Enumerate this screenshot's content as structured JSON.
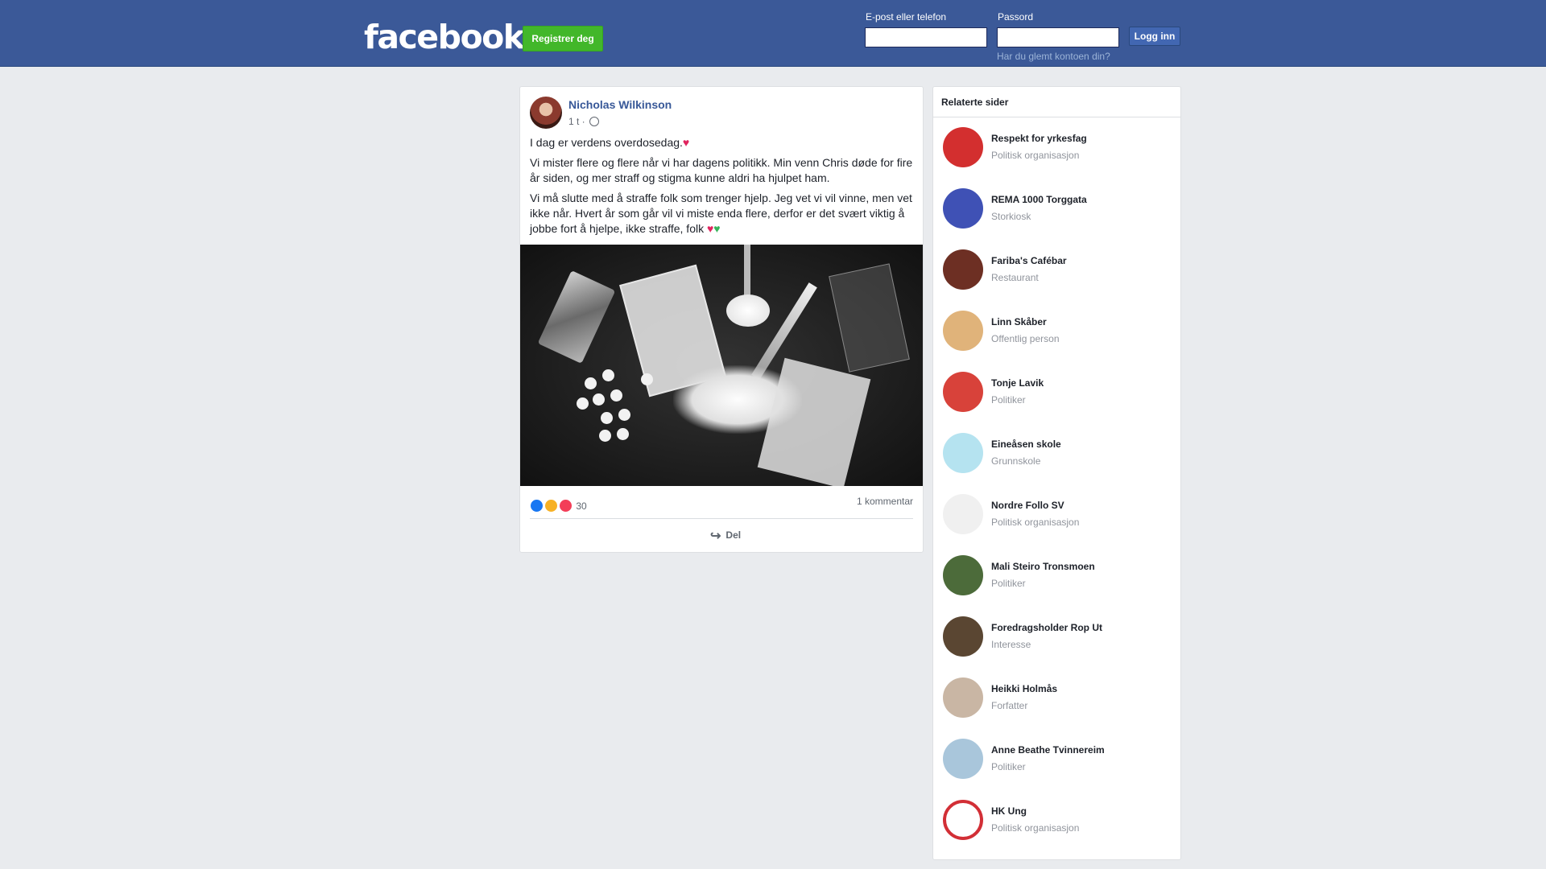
{
  "header": {
    "logo": "facebook",
    "register_label": "Registrer deg",
    "email_label": "E-post eller telefon",
    "password_label": "Passord",
    "login_label": "Logg inn",
    "forgot_label": "Har du glemt kontoen din?"
  },
  "post": {
    "author": "Nicholas Wilkinson",
    "time": "1 t",
    "paragraphs": [
      "I dag er verdens overdosedag.",
      "Vi mister flere og flere når vi har dagens politikk. Min venn Chris døde for fire år siden, og mer straff og stigma kunne aldri ha hjulpet ham.",
      "Vi må slutte med å straffe folk som trenger hjelp. Jeg vet vi vil vinne, men vet ikke når. Hvert år som går vil vi miste enda flere, derfor er det svært viktig å jobbe fort å hjelpe, ikke straffe, folk"
    ],
    "reaction_count": "30",
    "comments": "1 kommentar",
    "share_label": "Del"
  },
  "sidebar": {
    "title": "Relaterte sider",
    "items": [
      {
        "name": "Respekt for yrkesfag",
        "category": "Politisk organisasjon",
        "color": "#d32f2f"
      },
      {
        "name": "REMA 1000 Torggata",
        "category": "Storkiosk",
        "color": "#3f51b5"
      },
      {
        "name": "Fariba's Cafébar",
        "category": "Restaurant",
        "color": "#6d2f23"
      },
      {
        "name": "Linn Skåber",
        "category": "Offentlig person",
        "color": "#e0b37a"
      },
      {
        "name": "Tonje Lavik",
        "category": "Politiker",
        "color": "#d8423a"
      },
      {
        "name": "Eineåsen skole",
        "category": "Grunnskole",
        "color": "#b5e3f0"
      },
      {
        "name": "Nordre Follo SV",
        "category": "Politisk organisasjon",
        "color": "#f0f0f0"
      },
      {
        "name": "Mali Steiro Tronsmoen",
        "category": "Politiker",
        "color": "#4c6b3a"
      },
      {
        "name": "Foredragsholder Rop Ut",
        "category": "Interesse",
        "color": "#5a4632"
      },
      {
        "name": "Heikki Holmås",
        "category": "Forfatter",
        "color": "#c9b6a4"
      },
      {
        "name": "Anne Beathe Tvinnereim",
        "category": "Politiker",
        "color": "#a9c6db"
      },
      {
        "name": "HK Ung",
        "category": "Politisk organisasjon",
        "color": "#ffffff"
      }
    ]
  }
}
